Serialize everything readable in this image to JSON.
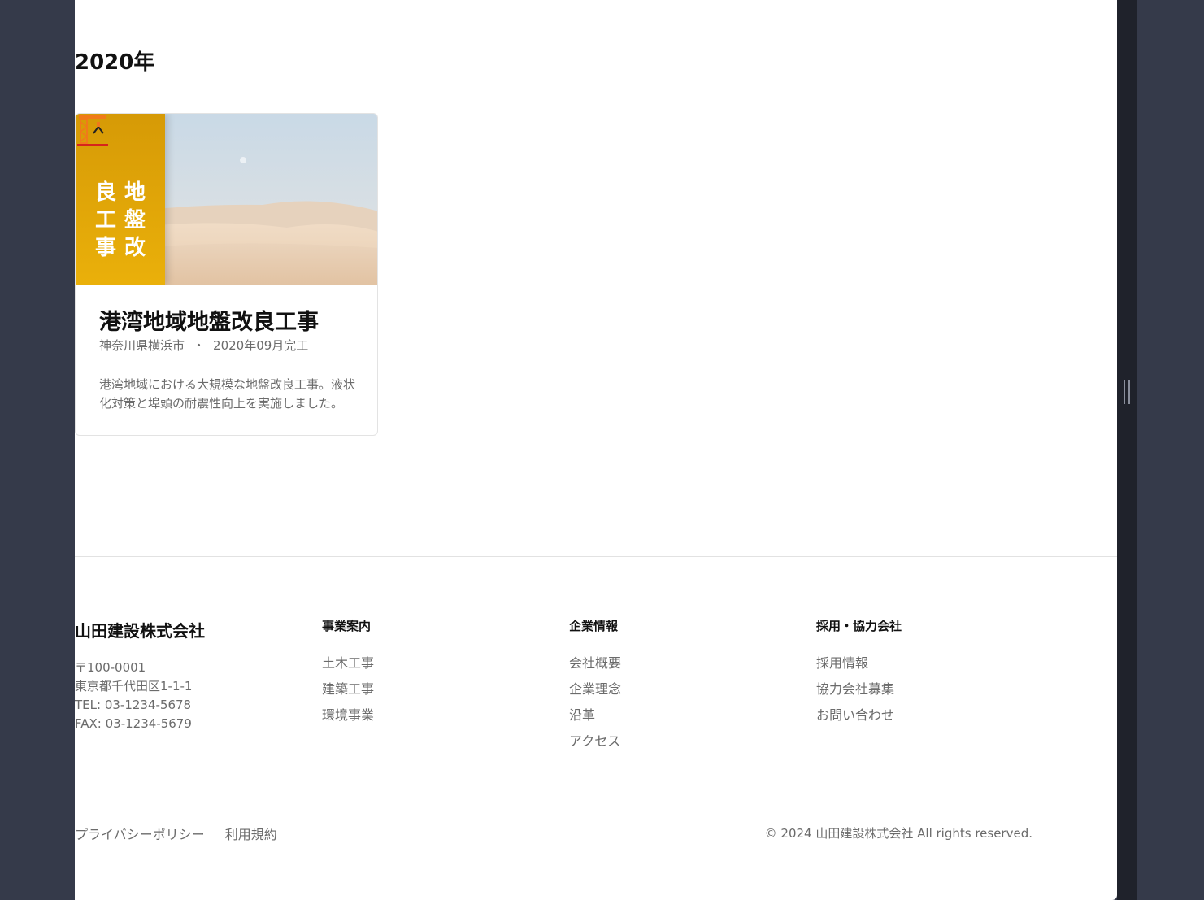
{
  "projects_section": {
    "year": "2020年",
    "cards": [
      {
        "badge_lines": [
          "地盤改",
          "良工事"
        ],
        "title": "港湾地域地盤改良工事",
        "location": "神奈川県横浜市",
        "separator": "・",
        "completed": "2020年09月完工",
        "description": "港湾地域における大規模な地盤改良工事。液状化対策と埠頭の耐震性向上を実施しました。"
      }
    ]
  },
  "footer": {
    "company_name": "山田建設株式会社",
    "address_lines": [
      "〒100-0001",
      "東京都千代田区1-1-1",
      "TEL: 03-1234-5678",
      "FAX: 03-1234-5679"
    ],
    "columns": [
      {
        "title": "事業案内",
        "links": [
          "土木工事",
          "建築工事",
          "環境事業"
        ]
      },
      {
        "title": "企業情報",
        "links": [
          "会社概要",
          "企業理念",
          "沿革",
          "アクセス"
        ]
      },
      {
        "title": "採用・協力会社",
        "links": [
          "採用情報",
          "協力会社募集",
          "お問い合わせ"
        ]
      }
    ],
    "legal_links": [
      "プライバシーポリシー",
      "利用規約"
    ],
    "copyright": "© 2024 山田建設株式会社 All rights reserved."
  },
  "colors": {
    "background": "#353a4a",
    "badge": "#e0a508",
    "text_muted": "#6b6b6b"
  },
  "icons": {
    "badge_logo": "construction-crane-icon",
    "resize_handle": "grip-icon"
  }
}
